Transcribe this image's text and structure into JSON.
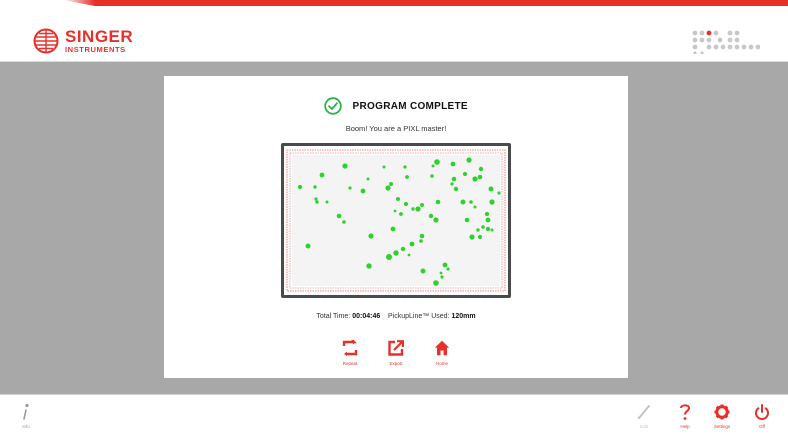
{
  "header": {
    "brand_line1": "SINGER",
    "brand_line2": "INSTRUMENTS",
    "brand_color": "#e8302a"
  },
  "dialog": {
    "title": "PROGRAM COMPLETE",
    "subtitle": "Boom! You are a PIXL master!",
    "check_color": "#2bb14a",
    "colony_color": "#2ed12e",
    "stats": {
      "total_time_label": "Total Time:",
      "total_time_value": "00:04:46",
      "pickup_label": "PickupLine™ Used:",
      "pickup_value": "120mm"
    },
    "actions": [
      {
        "label": "Repeat",
        "icon": "repeat-icon"
      },
      {
        "label": "Export",
        "icon": "export-icon"
      },
      {
        "label": "Home",
        "icon": "home-icon"
      }
    ]
  },
  "footer": {
    "info": {
      "label": "Info",
      "icon": "info-icon"
    },
    "edit": {
      "label": "Edit",
      "icon": "pencil-icon"
    },
    "help": {
      "label": "Help",
      "icon": "question-icon"
    },
    "settings": {
      "label": "Settings",
      "icon": "gear-icon"
    },
    "off": {
      "label": "Off",
      "icon": "power-icon"
    }
  }
}
